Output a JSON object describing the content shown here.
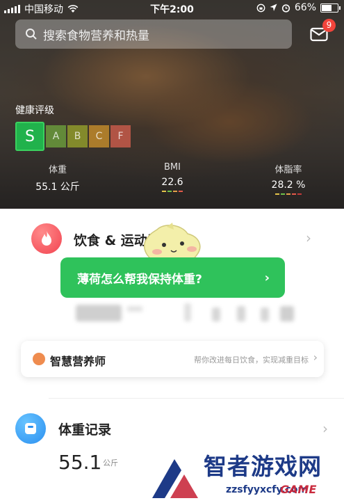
{
  "status_bar": {
    "carrier": "中国移动",
    "time": "下午2:00",
    "battery": "66%"
  },
  "search": {
    "placeholder": "搜索食物营养和热量"
  },
  "messages": {
    "badge_count": "9"
  },
  "health": {
    "title": "健康评级",
    "grades": [
      "S",
      "A",
      "B",
      "C",
      "F"
    ],
    "selected_grade": "S",
    "grade_colors": [
      "#21b24c",
      "#6a9a3c",
      "#8f9a2c",
      "#c08a2c",
      "#c55a4a"
    ]
  },
  "metrics": [
    {
      "label": "体重",
      "value": "55.1 公斤"
    },
    {
      "label": "BMI",
      "value": "22.6"
    },
    {
      "label": "体脂率",
      "value": "28.2 %"
    }
  ],
  "diet": {
    "title": "饮食 & 运动记录"
  },
  "tip": {
    "text": "薄荷怎么帮我保持体重?",
    "arrow": "›"
  },
  "nutritionist": {
    "title": "智慧营养师",
    "subtitle": "帮你改进每日饮食，实现减重目标"
  },
  "weight": {
    "title": "体重记录",
    "value": "55.1",
    "unit": "公斤"
  },
  "watermark": {
    "brand": "智者游戏网",
    "url": "zzsfyyxcfy.com",
    "game": "GAME"
  },
  "colors": {
    "accent_green": "#2fc25b",
    "diet_red": "#f24350",
    "weight_blue": "#2b90f0"
  }
}
